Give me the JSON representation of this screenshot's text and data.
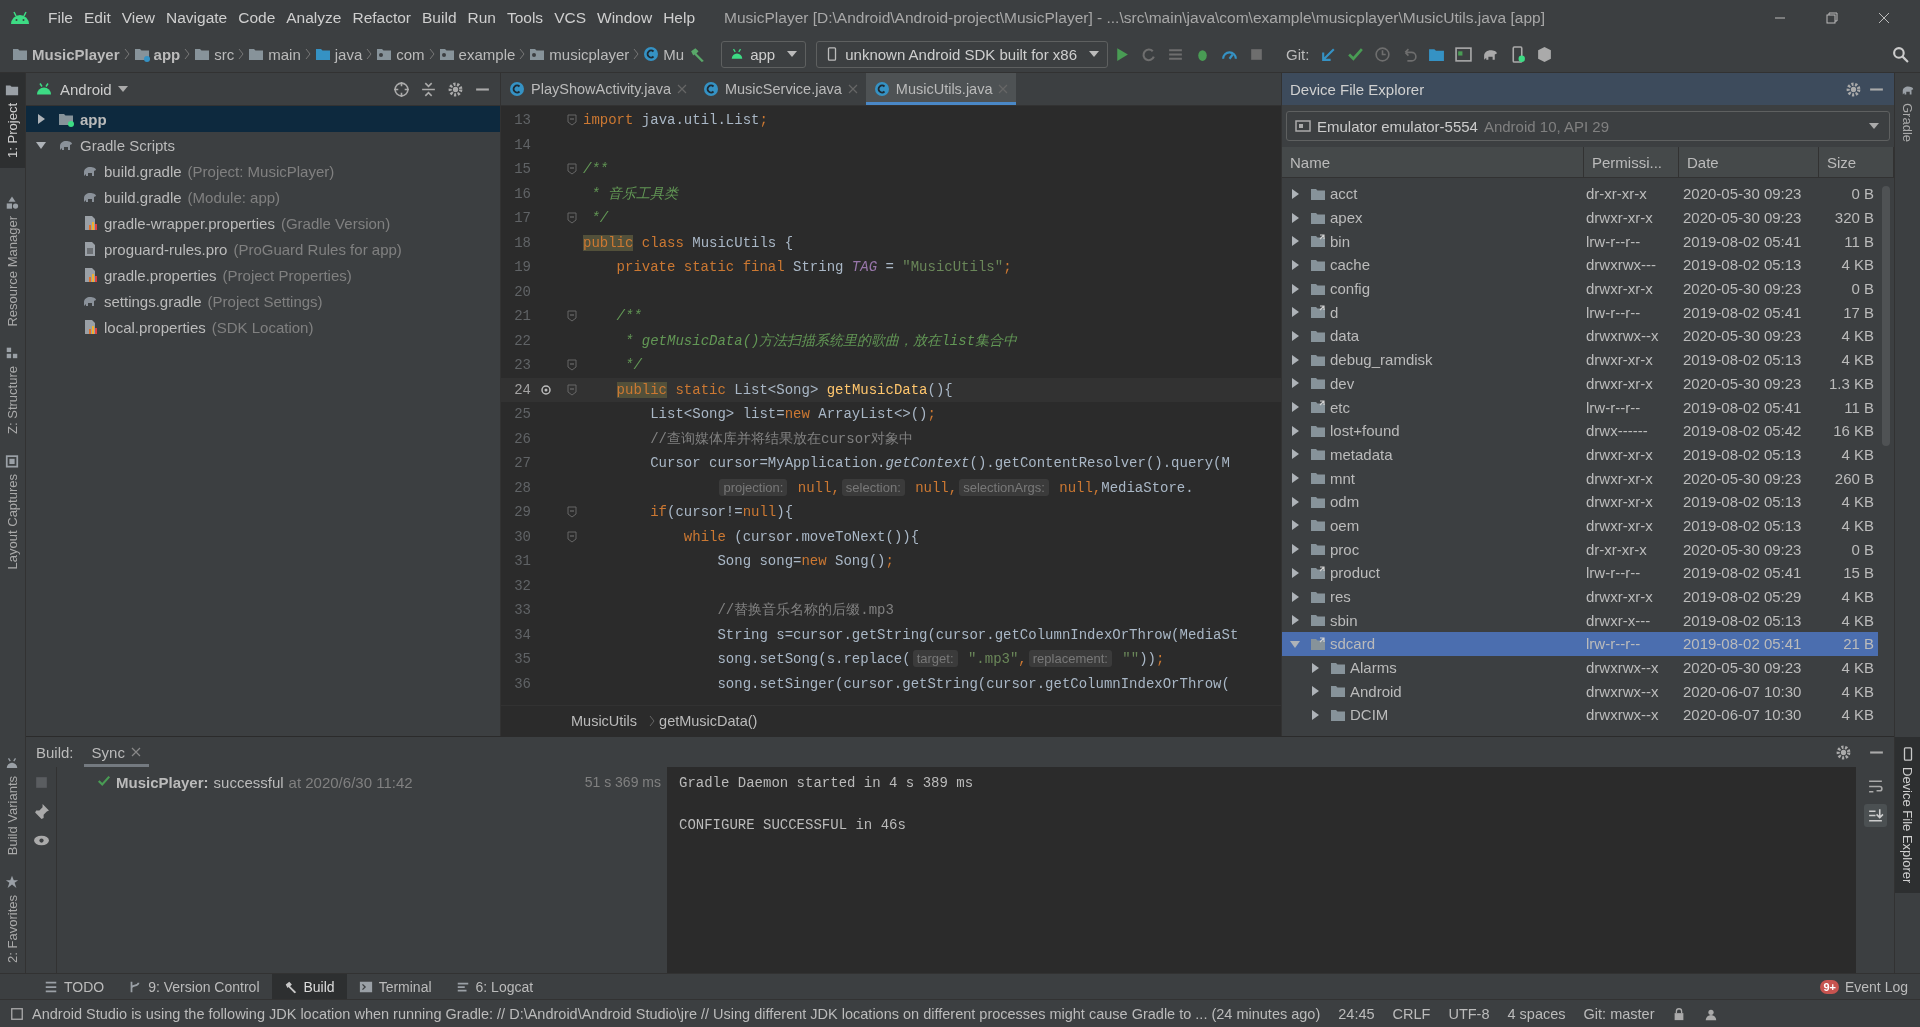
{
  "window": {
    "title": "MusicPlayer [D:\\Android\\Android-project\\MusicPlayer] - ...\\src\\main\\java\\com\\example\\musicplayer\\MusicUtils.java [app]"
  },
  "menu": [
    "File",
    "Edit",
    "View",
    "Navigate",
    "Code",
    "Analyze",
    "Refactor",
    "Build",
    "Run",
    "Tools",
    "VCS",
    "Window",
    "Help"
  ],
  "breadcrumbs": [
    {
      "label": "MusicPlayer",
      "kind": "project"
    },
    {
      "label": "app",
      "kind": "module"
    },
    {
      "label": "src",
      "kind": "folder"
    },
    {
      "label": "main",
      "kind": "folder"
    },
    {
      "label": "java",
      "kind": "source"
    },
    {
      "label": "com",
      "kind": "package"
    },
    {
      "label": "example",
      "kind": "package"
    },
    {
      "label": "musicplayer",
      "kind": "package"
    },
    {
      "label": "Mu",
      "kind": "class"
    }
  ],
  "run_config": "app",
  "device": "unknown Android SDK built for x86",
  "git_label": "Git:",
  "left_tabs": [
    {
      "label": "1: Project",
      "selected": true,
      "kind": "folder"
    },
    {
      "label": "Resource Manager",
      "selected": false,
      "kind": "shapes"
    },
    {
      "label": "Z: Structure",
      "selected": false,
      "kind": "structure"
    },
    {
      "label": "Layout Captures",
      "selected": false,
      "kind": "layout"
    },
    {
      "label": "Build Variants",
      "selected": false,
      "kind": "android"
    },
    {
      "label": "2: Favorites",
      "selected": false,
      "kind": "star"
    }
  ],
  "right_tabs": [
    {
      "label": "Gradle",
      "selected": false,
      "kind": "gradle"
    },
    {
      "label": "Device File Explorer",
      "selected": true,
      "kind": "phone"
    }
  ],
  "project": {
    "view": "Android",
    "items": [
      {
        "label": "app",
        "kind": "module",
        "expanded": false,
        "selected": true
      },
      {
        "label": "Gradle Scripts",
        "kind": "gradle",
        "expanded": true,
        "selected": false,
        "children": [
          {
            "label": "build.gradle",
            "hint": "(Project: MusicPlayer)",
            "kind": "gradle",
            "selected": false
          },
          {
            "label": "build.gradle",
            "hint": "(Module: app)",
            "kind": "gradle",
            "selected": false
          },
          {
            "label": "gradle-wrapper.properties",
            "hint": "(Gradle Version)",
            "kind": "properties",
            "selected": false
          },
          {
            "label": "proguard-rules.pro",
            "hint": "(ProGuard Rules for app)",
            "kind": "text",
            "selected": false
          },
          {
            "label": "gradle.properties",
            "hint": "(Project Properties)",
            "kind": "properties",
            "selected": false
          },
          {
            "label": "settings.gradle",
            "hint": "(Project Settings)",
            "kind": "gradle",
            "selected": false
          },
          {
            "label": "local.properties",
            "hint": "(SDK Location)",
            "kind": "properties",
            "selected": false
          }
        ]
      }
    ]
  },
  "editor": {
    "tabs": [
      {
        "label": "PlayShowActivity.java",
        "selected": false
      },
      {
        "label": "MusicService.java",
        "selected": false
      },
      {
        "label": "MusicUtils.java",
        "selected": true
      }
    ],
    "lines": [
      {
        "number": "13",
        "fold": true,
        "current": false,
        "tokens": [
          {
            "kind": "kw",
            "text": "import"
          },
          {
            "kind": "plain",
            "text": " java.util.List"
          },
          {
            "kind": "kw",
            "text": ";"
          }
        ]
      },
      {
        "number": "14",
        "fold": false,
        "current": false
      },
      {
        "number": "15",
        "fold": true,
        "current": false,
        "tokens": [
          {
            "kind": "doc",
            "text": "/**"
          }
        ]
      },
      {
        "number": "16",
        "fold": false,
        "current": false,
        "tokens": [
          {
            "kind": "doc",
            "text": " * 音乐工具类"
          }
        ]
      },
      {
        "number": "17",
        "fold": true,
        "current": false,
        "tokens": [
          {
            "kind": "doc",
            "text": " */"
          }
        ]
      },
      {
        "number": "18",
        "fold": false,
        "current": false,
        "tokens": [
          {
            "kind": "kwmark",
            "text": "public"
          },
          {
            "kind": "kw",
            "text": " class"
          },
          {
            "kind": "plain",
            "text": " MusicUtils {"
          }
        ]
      },
      {
        "number": "19",
        "fold": false,
        "current": false,
        "tokens": [
          {
            "kind": "kw",
            "text": "    private static final"
          },
          {
            "kind": "plain",
            "text": " String "
          },
          {
            "kind": "const",
            "text": "TAG"
          },
          {
            "kind": "plain",
            "text": " = "
          },
          {
            "kind": "str",
            "text": "\"MusicUtils\""
          },
          {
            "kind": "kw",
            "text": ";"
          }
        ]
      },
      {
        "number": "20",
        "fold": false,
        "current": false
      },
      {
        "number": "21",
        "fold": true,
        "current": false,
        "tokens": [
          {
            "kind": "doc",
            "text": "    /**"
          }
        ]
      },
      {
        "number": "22",
        "fold": false,
        "current": false,
        "tokens": [
          {
            "kind": "doc",
            "text": "     * getMusicData()方法扫描系统里的歌曲，放在list集合中"
          }
        ]
      },
      {
        "number": "23",
        "fold": true,
        "current": false,
        "tokens": [
          {
            "kind": "doc",
            "text": "     */"
          }
        ]
      },
      {
        "number": "24",
        "fold": true,
        "current": true,
        "tokens": [
          {
            "kind": "kwmark",
            "text": "    public"
          },
          {
            "kind": "kw",
            "text": " static"
          },
          {
            "kind": "plain",
            "text": " List<Song> "
          },
          {
            "kind": "method",
            "text": "getMusicData"
          },
          {
            "kind": "plain",
            "text": "(){"
          }
        ]
      },
      {
        "number": "25",
        "fold": false,
        "current": false,
        "tokens": [
          {
            "kind": "plain",
            "text": "        List<Song> list="
          },
          {
            "kind": "kw",
            "text": "new"
          },
          {
            "kind": "plain",
            "text": " ArrayList<>()"
          },
          {
            "kind": "kw",
            "text": ";"
          }
        ]
      },
      {
        "number": "26",
        "fold": false,
        "current": false,
        "tokens": [
          {
            "kind": "cmt",
            "text": "        //查询媒体库并将结果放在cursor对象中"
          }
        ]
      },
      {
        "number": "27",
        "fold": false,
        "current": false,
        "tokens": [
          {
            "kind": "plain",
            "text": "        Cursor cursor=MyApplication."
          },
          {
            "kind": "static",
            "text": "getContext"
          },
          {
            "kind": "plain",
            "text": "().getContentResolver().query(M"
          }
        ]
      },
      {
        "number": "28",
        "fold": false,
        "current": false,
        "tokens": [
          {
            "kind": "hint",
            "text": "                projection:"
          },
          {
            "kind": "kw",
            "text": " null,"
          },
          {
            "kind": "hint",
            "text": "selection:"
          },
          {
            "kind": "kw",
            "text": " null,"
          },
          {
            "kind": "hint",
            "text": "selectionArgs:"
          },
          {
            "kind": "kw",
            "text": " null,"
          },
          {
            "kind": "plain",
            "text": "MediaStore."
          }
        ]
      },
      {
        "number": "29",
        "fold": true,
        "current": false,
        "tokens": [
          {
            "kind": "kw",
            "text": "        if"
          },
          {
            "kind": "plain",
            "text": "(cursor!="
          },
          {
            "kind": "kw",
            "text": "null"
          },
          {
            "kind": "plain",
            "text": "){"
          }
        ]
      },
      {
        "number": "30",
        "fold": true,
        "current": false,
        "tokens": [
          {
            "kind": "kw",
            "text": "            while"
          },
          {
            "kind": "plain",
            "text": " (cursor.moveToNext()){"
          }
        ]
      },
      {
        "number": "31",
        "fold": false,
        "current": false,
        "tokens": [
          {
            "kind": "plain",
            "text": "                Song song="
          },
          {
            "kind": "kw",
            "text": "new"
          },
          {
            "kind": "plain",
            "text": " Song()"
          },
          {
            "kind": "kw",
            "text": ";"
          }
        ]
      },
      {
        "number": "32",
        "fold": false,
        "current": false
      },
      {
        "number": "33",
        "fold": false,
        "current": false,
        "tokens": [
          {
            "kind": "cmt",
            "text": "                //替换音乐名称的后缀.mp3"
          }
        ]
      },
      {
        "number": "34",
        "fold": false,
        "current": false,
        "tokens": [
          {
            "kind": "plain",
            "text": "                String s=cursor.getString(cursor.getColumnIndexOrThrow(MediaSt"
          }
        ]
      },
      {
        "number": "35",
        "fold": false,
        "current": false,
        "tokens": [
          {
            "kind": "plain",
            "text": "                song.setSong(s.replace("
          },
          {
            "kind": "hint",
            "text": "target:"
          },
          {
            "kind": "str",
            "text": " \".mp3\""
          },
          {
            "kind": "kw",
            "text": ","
          },
          {
            "kind": "hint",
            "text": "replacement:"
          },
          {
            "kind": "str",
            "text": " \"\""
          },
          {
            "kind": "plain",
            "text": "))"
          },
          {
            "kind": "kw",
            "text": ";"
          }
        ]
      },
      {
        "number": "36",
        "fold": false,
        "current": false,
        "tokens": [
          {
            "kind": "plain",
            "text": "                song.setSinger(cursor.getString(cursor.getColumnIndexOrThrow("
          }
        ]
      }
    ],
    "breadcrumb": [
      "MusicUtils",
      "getMusicData()"
    ]
  },
  "explorer": {
    "title": "Device File Explorer",
    "device": "Emulator emulator-5554",
    "device_detail": "Android 10, API 29",
    "columns": [
      "Name",
      "Permissi...",
      "Date",
      "Size"
    ],
    "rows": [
      {
        "name": "acct",
        "link": false,
        "expanded": false,
        "selected": false,
        "permissions": "dr-xr-xr-x",
        "date": "2020-05-30 09:23",
        "size": "0 B"
      },
      {
        "name": "apex",
        "link": false,
        "expanded": false,
        "selected": false,
        "permissions": "drwxr-xr-x",
        "date": "2020-05-30 09:23",
        "size": "320 B"
      },
      {
        "name": "bin",
        "link": true,
        "expanded": false,
        "selected": false,
        "permissions": "lrw-r--r--",
        "date": "2019-08-02 05:41",
        "size": "11 B"
      },
      {
        "name": "cache",
        "link": false,
        "expanded": false,
        "selected": false,
        "permissions": "drwxrwx---",
        "date": "2019-08-02 05:13",
        "size": "4 KB"
      },
      {
        "name": "config",
        "link": false,
        "expanded": false,
        "selected": false,
        "permissions": "drwxr-xr-x",
        "date": "2020-05-30 09:23",
        "size": "0 B"
      },
      {
        "name": "d",
        "link": true,
        "expanded": false,
        "selected": false,
        "permissions": "lrw-r--r--",
        "date": "2019-08-02 05:41",
        "size": "17 B"
      },
      {
        "name": "data",
        "link": false,
        "expanded": false,
        "selected": false,
        "permissions": "drwxrwx--x",
        "date": "2020-05-30 09:23",
        "size": "4 KB"
      },
      {
        "name": "debug_ramdisk",
        "link": false,
        "expanded": false,
        "selected": false,
        "permissions": "drwxr-xr-x",
        "date": "2019-08-02 05:13",
        "size": "4 KB"
      },
      {
        "name": "dev",
        "link": false,
        "expanded": false,
        "selected": false,
        "permissions": "drwxr-xr-x",
        "date": "2020-05-30 09:23",
        "size": "1.3 KB"
      },
      {
        "name": "etc",
        "link": true,
        "expanded": false,
        "selected": false,
        "permissions": "lrw-r--r--",
        "date": "2019-08-02 05:41",
        "size": "11 B"
      },
      {
        "name": "lost+found",
        "link": false,
        "expanded": false,
        "selected": false,
        "permissions": "drwx------",
        "date": "2019-08-02 05:42",
        "size": "16 KB"
      },
      {
        "name": "metadata",
        "link": false,
        "expanded": false,
        "selected": false,
        "permissions": "drwxr-xr-x",
        "date": "2019-08-02 05:13",
        "size": "4 KB"
      },
      {
        "name": "mnt",
        "link": false,
        "expanded": false,
        "selected": false,
        "permissions": "drwxr-xr-x",
        "date": "2020-05-30 09:23",
        "size": "260 B"
      },
      {
        "name": "odm",
        "link": false,
        "expanded": false,
        "selected": false,
        "permissions": "drwxr-xr-x",
        "date": "2019-08-02 05:13",
        "size": "4 KB"
      },
      {
        "name": "oem",
        "link": false,
        "expanded": false,
        "selected": false,
        "permissions": "drwxr-xr-x",
        "date": "2019-08-02 05:13",
        "size": "4 KB"
      },
      {
        "name": "proc",
        "link": false,
        "expanded": false,
        "selected": false,
        "permissions": "dr-xr-xr-x",
        "date": "2020-05-30 09:23",
        "size": "0 B"
      },
      {
        "name": "product",
        "link": true,
        "expanded": false,
        "selected": false,
        "permissions": "lrw-r--r--",
        "date": "2019-08-02 05:41",
        "size": "15 B"
      },
      {
        "name": "res",
        "link": false,
        "expanded": false,
        "selected": false,
        "permissions": "drwxr-xr-x",
        "date": "2019-08-02 05:29",
        "size": "4 KB"
      },
      {
        "name": "sbin",
        "link": false,
        "expanded": false,
        "selected": false,
        "permissions": "drwxr-x---",
        "date": "2019-08-02 05:13",
        "size": "4 KB"
      },
      {
        "name": "sdcard",
        "link": true,
        "expanded": true,
        "selected": true,
        "permissions": "lrw-r--r--",
        "date": "2019-08-02 05:41",
        "size": "21 B",
        "children": [
          {
            "name": "Alarms",
            "link": false,
            "expanded": false,
            "selected": false,
            "permissions": "drwxrwx--x",
            "date": "2020-05-30 09:23",
            "size": "4 KB"
          },
          {
            "name": "Android",
            "link": false,
            "expanded": false,
            "selected": false,
            "permissions": "drwxrwx--x",
            "date": "2020-06-07 10:30",
            "size": "4 KB"
          },
          {
            "name": "DCIM",
            "link": false,
            "expanded": false,
            "selected": false,
            "permissions": "drwxrwx--x",
            "date": "2020-06-07 10:30",
            "size": "4 KB"
          }
        ]
      }
    ]
  },
  "build": {
    "label": "Build:",
    "tabs": [
      {
        "label": "Sync",
        "selected": true
      }
    ],
    "result": {
      "success": true,
      "name": "MusicPlayer:",
      "status": "successful",
      "when": "at 2020/6/30 11:42",
      "duration": "51 s 369 ms"
    },
    "console": [
      "Gradle Daemon started in 4 s 389 ms",
      "CONFIGURE SUCCESSFUL in 46s"
    ]
  },
  "tool_tabs": [
    {
      "label": "TODO",
      "kind": "list",
      "selected": false
    },
    {
      "label": "9: Version Control",
      "kind": "vcs",
      "selected": false
    },
    {
      "label": "Build",
      "kind": "hammer",
      "selected": true
    },
    {
      "label": "Terminal",
      "kind": "terminal",
      "selected": false
    },
    {
      "label": "6: Logcat",
      "kind": "logcat",
      "selected": false
    }
  ],
  "event_log": {
    "label": "Event Log",
    "badge": "9+"
  },
  "status_bar": {
    "message": "Android Studio is using the following JDK location when running Gradle: // D:\\Android\\Android Studio\\jre // Using different JDK locations on different processes might cause Gradle to ... (24 minutes ago)",
    "items": [
      "24:45",
      "CRLF",
      "UTF-8",
      "4 spaces",
      "Git: master"
    ]
  }
}
